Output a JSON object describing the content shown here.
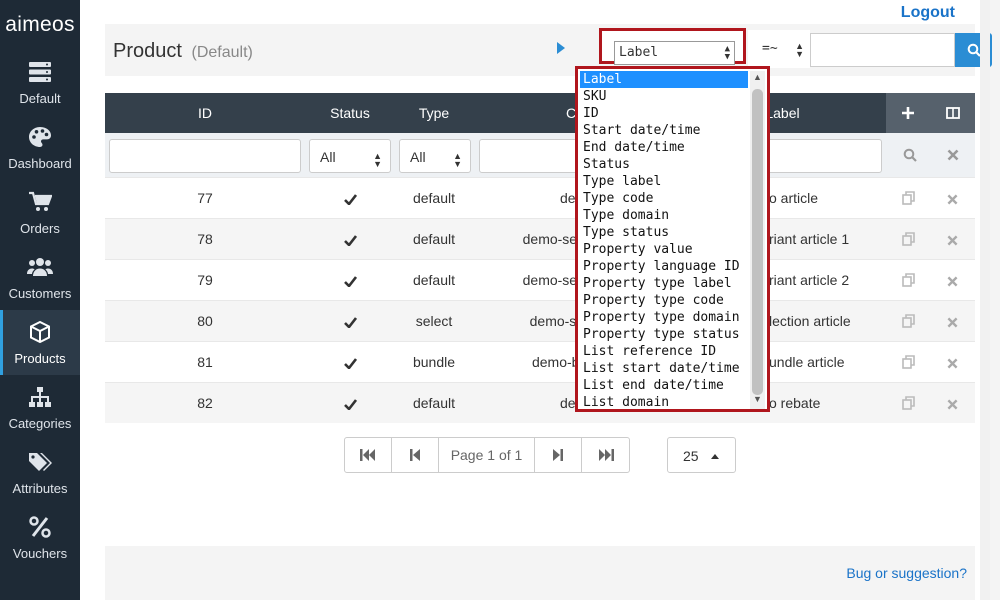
{
  "sidebar": {
    "logo": "aimeos",
    "items": [
      {
        "label": "Default",
        "icon": "server-icon"
      },
      {
        "label": "Dashboard",
        "icon": "palette-icon"
      },
      {
        "label": "Orders",
        "icon": "cart-icon"
      },
      {
        "label": "Customers",
        "icon": "users-icon"
      },
      {
        "label": "Products",
        "icon": "box-icon"
      },
      {
        "label": "Categories",
        "icon": "sitemap-icon"
      },
      {
        "label": "Attributes",
        "icon": "tags-icon"
      },
      {
        "label": "Vouchers",
        "icon": "percent-icon"
      }
    ],
    "active_index": 4
  },
  "header": {
    "logout": "Logout",
    "title": "Product",
    "subtitle": "(Default)"
  },
  "search": {
    "field_value": "Label",
    "operator_value": "=~",
    "query_value": ""
  },
  "dropdown": {
    "options": [
      "Label",
      "SKU",
      "ID",
      "Start date/time",
      "End date/time",
      "Status",
      "Type label",
      "Type code",
      "Type domain",
      "Type status",
      "Property value",
      "Property language ID",
      "Property type label",
      "Property type code",
      "Property type domain",
      "Property type status",
      "List reference ID",
      "List start date/time",
      "List end date/time",
      "List domain"
    ],
    "selected_index": 0
  },
  "table": {
    "columns": [
      "ID",
      "Status",
      "Type",
      "Co",
      "Label"
    ],
    "filter_status": "All",
    "filter_type": "All",
    "rows": [
      {
        "id": "77",
        "type": "default",
        "code": "demo",
        "label": "o article"
      },
      {
        "id": "78",
        "type": "default",
        "code": "demo-selec",
        "label": "riant article 1"
      },
      {
        "id": "79",
        "type": "default",
        "code": "demo-selec",
        "label": "riant article 2"
      },
      {
        "id": "80",
        "type": "select",
        "code": "demo-sele",
        "label": "lection article"
      },
      {
        "id": "81",
        "type": "bundle",
        "code": "demo-bun",
        "label": "undle article"
      },
      {
        "id": "82",
        "type": "default",
        "code": "demo",
        "label": "o rebate"
      }
    ]
  },
  "pagination": {
    "page_label": "Page 1 of 1",
    "page_size": "25"
  },
  "footer": {
    "link": "Bug or suggestion?"
  },
  "colors": {
    "sidebar_bg": "#1e2a36",
    "accent": "#2b8dd4",
    "highlight_border": "#b0161d",
    "table_header": "#34404b"
  }
}
